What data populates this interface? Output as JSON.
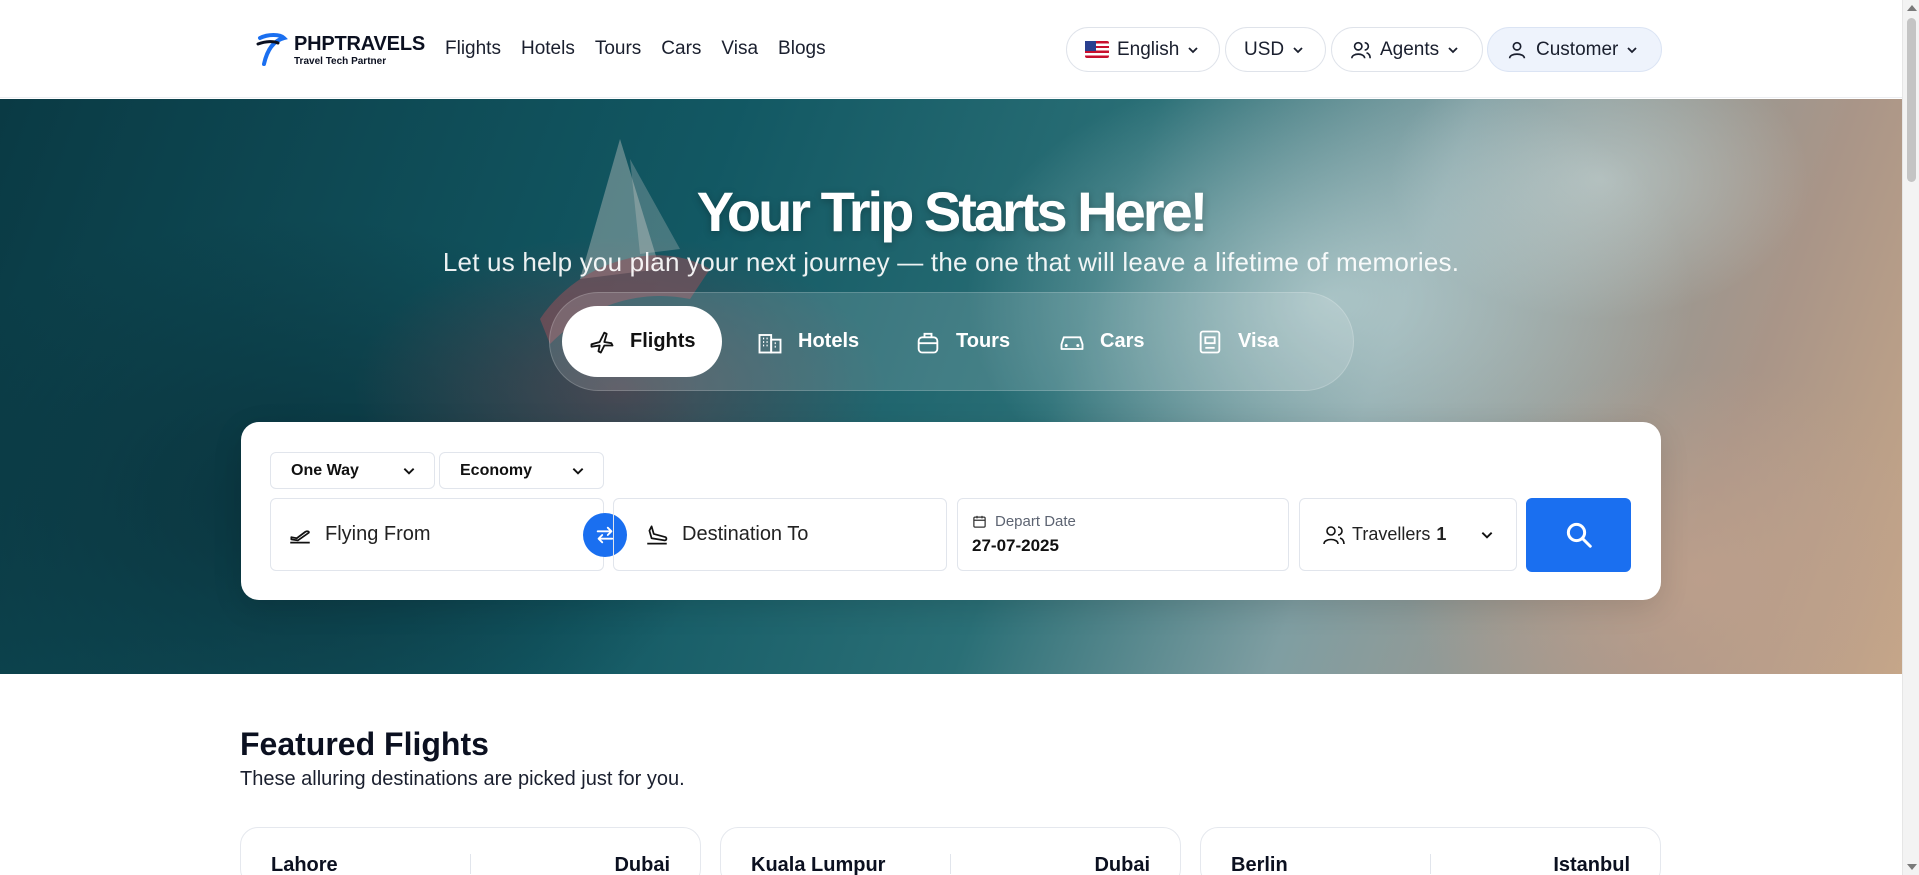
{
  "header": {
    "brand_name": "PHPTRAVELS",
    "brand_tagline": "Travel Tech Partner",
    "nav": [
      {
        "label": "Flights"
      },
      {
        "label": "Hotels"
      },
      {
        "label": "Tours"
      },
      {
        "label": "Cars"
      },
      {
        "label": "Visa"
      },
      {
        "label": "Blogs"
      }
    ],
    "language": "English",
    "currency": "USD",
    "agents": "Agents",
    "customer": "Customer"
  },
  "hero": {
    "title": "Your Trip Starts Here!",
    "subtitle": "Let us help you plan your next journey — the one that will leave a lifetime of memories."
  },
  "tabs": [
    {
      "label": "Flights",
      "icon": "plane-icon",
      "active": true
    },
    {
      "label": "Hotels",
      "icon": "building-icon"
    },
    {
      "label": "Tours",
      "icon": "luggage-icon"
    },
    {
      "label": "Cars",
      "icon": "car-icon"
    },
    {
      "label": "Visa",
      "icon": "passport-icon"
    }
  ],
  "search": {
    "trip_type": "One Way",
    "cabin_class": "Economy",
    "from_placeholder": "Flying From",
    "to_placeholder": "Destination To",
    "depart_label": "Depart Date",
    "depart_value": "27-07-2025",
    "travellers_label": "Travellers",
    "travellers_count": "1"
  },
  "featured": {
    "title": "Featured Flights",
    "subtitle": "These alluring destinations are picked just for you.",
    "cards": [
      {
        "from": "Lahore",
        "to": "Dubai"
      },
      {
        "from": "Kuala Lumpur",
        "to": "Dubai"
      },
      {
        "from": "Berlin",
        "to": "Istanbul"
      }
    ]
  },
  "colors": {
    "accent": "#1a6ff0",
    "text_dark": "#0b1020"
  }
}
